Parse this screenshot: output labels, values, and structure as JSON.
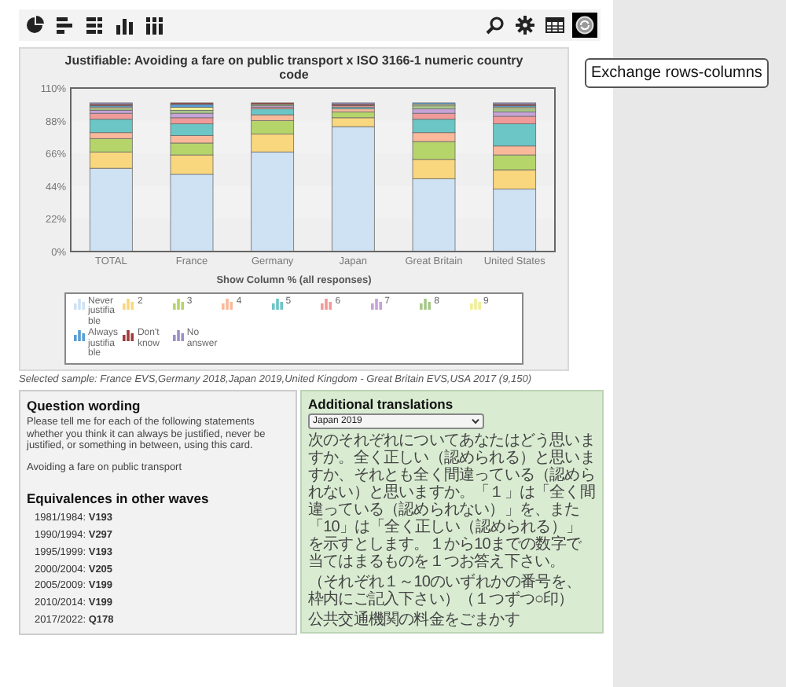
{
  "toolbar": {
    "tools": [
      {
        "kind": "pie",
        "selected": false
      },
      {
        "kind": "bars",
        "selected": false
      },
      {
        "kind": "stacked-bars",
        "selected": false
      },
      {
        "kind": "columns",
        "selected": false
      },
      {
        "kind": "stacked-columns",
        "selected": false
      },
      {
        "kind": "zoom",
        "selected": false
      },
      {
        "kind": "settings",
        "selected": false
      },
      {
        "kind": "table",
        "selected": false
      },
      {
        "kind": "exchange",
        "selected": true
      }
    ],
    "tooltip": "Exchange rows-columns"
  },
  "chart": {
    "chart_data": {
      "type": "bar",
      "stacked": true,
      "title": "Justifiable: Avoiding a fare on public transport x ISO 3166-1 numeric country code",
      "xlabel": "Show Column % (all responses)",
      "ylim": [
        0,
        110
      ],
      "yticks": [
        {
          "value": 0,
          "label": "0%"
        },
        {
          "value": 22,
          "label": "22%"
        },
        {
          "value": 44,
          "label": "44%"
        },
        {
          "value": 66,
          "label": "66%"
        },
        {
          "value": 88,
          "label": "88%"
        },
        {
          "value": 110,
          "label": "110%"
        }
      ],
      "categories": [
        "TOTAL",
        "France",
        "Germany",
        "Japan",
        "Great Britain",
        "United States"
      ],
      "series": [
        {
          "name": "Never justifiable",
          "color": "#cfe2f3",
          "values": [
            56,
            52,
            67,
            84,
            49,
            42
          ]
        },
        {
          "name": "2",
          "color": "#f9d77e",
          "values": [
            11,
            13,
            12,
            6,
            13,
            13
          ]
        },
        {
          "name": "3",
          "color": "#b5d56a",
          "values": [
            9,
            8,
            9,
            4,
            12,
            10
          ]
        },
        {
          "name": "4",
          "color": "#f9b99a",
          "values": [
            4,
            5,
            4,
            2,
            6,
            6
          ]
        },
        {
          "name": "5",
          "color": "#6cc6c6",
          "values": [
            9,
            8,
            4,
            1,
            9,
            15
          ]
        },
        {
          "name": "6",
          "color": "#f19a9a",
          "values": [
            4,
            4,
            1,
            1,
            4,
            5
          ]
        },
        {
          "name": "7",
          "color": "#c7a3d8",
          "values": [
            2,
            3,
            1,
            0,
            3,
            3
          ]
        },
        {
          "name": "8",
          "color": "#a8c88a",
          "values": [
            1,
            2,
            1,
            0,
            2,
            2
          ]
        },
        {
          "name": "9",
          "color": "#f0ef9a",
          "values": [
            1,
            2,
            0,
            0,
            1,
            1
          ]
        },
        {
          "name": "Always justifiable",
          "color": "#5a9fd4",
          "values": [
            1,
            2,
            0,
            0,
            1,
            1
          ]
        },
        {
          "name": "Don't know",
          "color": "#a03c3c",
          "values": [
            1,
            1,
            1,
            1,
            0,
            1
          ]
        },
        {
          "name": "No answer",
          "color": "#9e8fc7",
          "values": [
            1,
            0,
            0,
            1,
            0,
            1
          ]
        }
      ]
    }
  },
  "sample_note": "Selected sample: France EVS,Germany 2018,Japan 2019,United Kingdom - Great Britain EVS,USA 2017 (9,150)",
  "question_wording": {
    "title": "Question wording",
    "text": "Please tell me for each of the following statements whether you think it can always be justified, never be justified, or something in between, using this card.",
    "item": "Avoiding a fare on public transport",
    "equivalences_title": "Equivalences in other waves",
    "equivalences": [
      {
        "period": "1981/1984:",
        "code": "V193"
      },
      {
        "period": "1990/1994:",
        "code": "V297"
      },
      {
        "period": "1995/1999:",
        "code": "V193"
      },
      {
        "period": "2000/2004:",
        "code": "V205"
      },
      {
        "period": "2005/2009:",
        "code": "V199"
      },
      {
        "period": "2010/2014:",
        "code": "V199"
      },
      {
        "period": "2017/2022:",
        "code": "Q178"
      }
    ]
  },
  "additional_translations": {
    "title": "Additional translations",
    "select": "Japan 2019",
    "paragraphs": [
      "次のそれぞれについてあなたはどう思いますか。全く正しい（認められる）と思いますか、それとも全く間違っている（認められない）と思いますか。「１」は「全く間違っている（認められない）」を、また「10」は「全く正しい（認められる）」を示すとします。１から10までの数字で当てはまるものを１つお答え下さい。",
      "（それぞれ１～10のいずれかの番号を、枠内にご記入下さい）（１つずつ○印）",
      "公共交通機関の料金をごまかす"
    ]
  }
}
